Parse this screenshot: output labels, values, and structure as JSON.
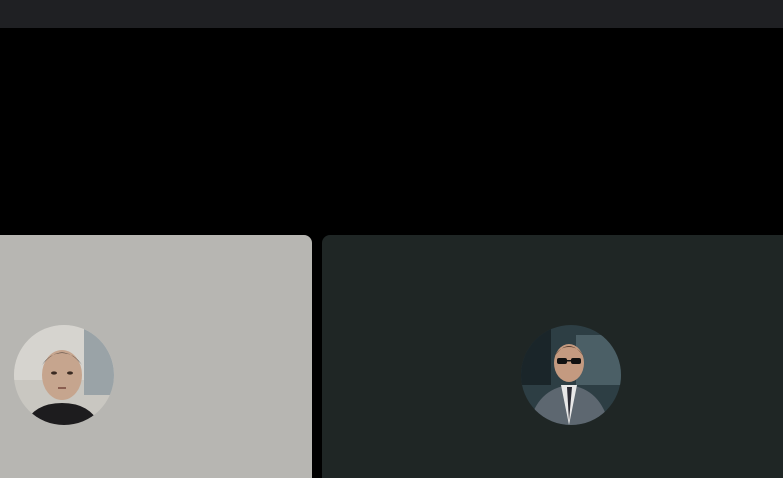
{
  "window": {
    "topbar_color": "#1f2023",
    "stage_color": "#000000"
  },
  "participants": [
    {
      "tile_color": "#b7b6b2",
      "avatar_icon": "participant-avatar-photo"
    },
    {
      "tile_color": "#1f2625",
      "avatar_icon": "participant-avatar-photo"
    }
  ]
}
